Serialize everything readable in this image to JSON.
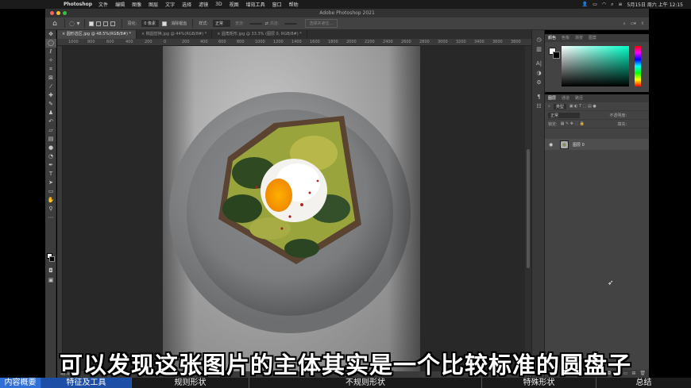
{
  "menubar": {
    "app_name": "Photoshop",
    "items": [
      "文件",
      "编辑",
      "图像",
      "图层",
      "文字",
      "选择",
      "滤镜",
      "3D",
      "视图",
      "增效工具",
      "窗口",
      "帮助"
    ],
    "datetime": "5月15日 周六 上午 12:15"
  },
  "window": {
    "title": "Adobe Photoshop 2021"
  },
  "options": {
    "feather_label": "羽化:",
    "feather_value": "0 像素",
    "antialias_label": "消除锯齿",
    "style_label": "样式:",
    "style_value": "正常",
    "width_label": "宽度:",
    "height_label": "高度:",
    "select_mask_label": "选择并遮住..."
  },
  "tabs": [
    "圆形选区.jpg @ 48.5%(RGB/8#) *",
    "椭圆替换.jpg @ 44%(RGB/8#) *",
    "圆角矩形.jpg @ 33.3% (图层 0, RGB/8#) *"
  ],
  "ruler": [
    "1000",
    "800",
    "600",
    "400",
    "200",
    "0",
    "200",
    "400",
    "600",
    "800",
    "1000",
    "1200",
    "1400",
    "1600",
    "1800",
    "2000",
    "2200",
    "2400",
    "2600",
    "2800",
    "3000",
    "3200",
    "3400",
    "3600",
    "3800",
    "4000"
  ],
  "status": {
    "zoom": "48.46%"
  },
  "color_panel": {
    "tabs": [
      "颜色",
      "色板",
      "渐变",
      "图案"
    ]
  },
  "layers_panel": {
    "tabs": [
      "图层",
      "通道",
      "路径"
    ],
    "kind_label": "类型",
    "blend_mode": "正常",
    "opacity_label": "不透明度:",
    "lock_label": "锁定:",
    "fill_label": "填充:",
    "layer_name": "图层 0"
  },
  "subtitle": "可以发现这张图片的主体其实是一个比较标准的圆盘子",
  "chapters": [
    "内容概要",
    "特征及工具",
    "规则形状",
    "不规则形状",
    "特殊形状",
    "总结"
  ],
  "colors": {
    "accent": "#2f6fd8",
    "ps_bg": "#282828"
  }
}
